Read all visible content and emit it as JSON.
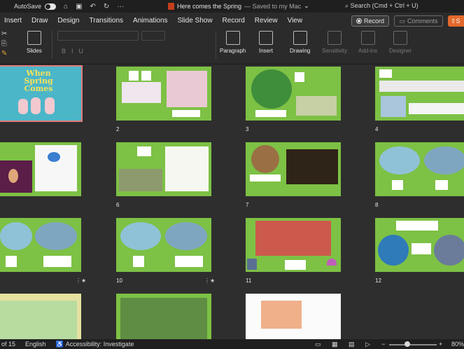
{
  "titlebar": {
    "autosave": "AutoSave",
    "doc_title": "Here comes the Spring",
    "saved": "— Saved to my Mac",
    "search": "Search (Cmd + Ctrl + U)"
  },
  "tabs": [
    "Insert",
    "Draw",
    "Design",
    "Transitions",
    "Animations",
    "Slide Show",
    "Record",
    "Review",
    "View"
  ],
  "actions": {
    "record": "Record",
    "comments": "Comments",
    "share": "S"
  },
  "ribbon": {
    "slides": "Slides",
    "paragraph": "Paragraph",
    "insert": "Insert",
    "drawing": "Drawing",
    "sensitivity": "Sensitivity",
    "addins": "Add-ins",
    "designer": "Designer"
  },
  "slide1": {
    "title_line1": "When",
    "title_line2": "Spring",
    "title_line3": "Comes"
  },
  "slide_numbers": {
    "n2": "2",
    "n3": "3",
    "n4": "4",
    "n6": "6",
    "n7": "7",
    "n8": "8",
    "n10": "10",
    "n11": "11",
    "n12": "12"
  },
  "status": {
    "slide_count": "of 15",
    "language": "English",
    "accessibility": "Accessibility: Investigate",
    "zoom": "80%"
  }
}
